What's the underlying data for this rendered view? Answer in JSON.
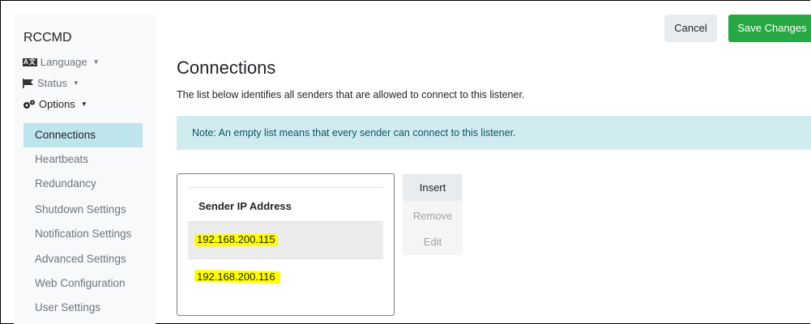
{
  "brand": "RCCMD",
  "sidebar": {
    "language": {
      "icon": "language-icon",
      "label": "Language"
    },
    "status": {
      "icon": "flag-icon",
      "label": "Status"
    },
    "options": {
      "icon": "gears-icon",
      "label": "Options"
    },
    "items": [
      {
        "label": "Connections",
        "active": true
      },
      {
        "label": "Heartbeats"
      },
      {
        "label": "Redundancy"
      },
      {
        "label": "Shutdown Settings"
      },
      {
        "label": "Notification Settings"
      },
      {
        "label": "Advanced Settings"
      },
      {
        "label": "Web Configuration"
      },
      {
        "label": "User Settings"
      }
    ]
  },
  "header": {
    "cancel_label": "Cancel",
    "save_label": "Save Changes"
  },
  "main": {
    "title": "Connections",
    "description": "The list below identifies all senders that are allowed to connect to this listener.",
    "note": "Note: An empty list means that every sender can connect to this listener.",
    "table": {
      "header": "Sender IP Address",
      "rows": [
        "192.168.200.115",
        "192.168.200.116"
      ]
    },
    "buttons": {
      "insert": "Insert",
      "remove": "Remove",
      "edit": "Edit"
    }
  },
  "colors": {
    "save": "#28a745",
    "alert_bg": "#d1ecf1",
    "active_bg": "#bfe5ec",
    "highlight": "#ffff00"
  }
}
